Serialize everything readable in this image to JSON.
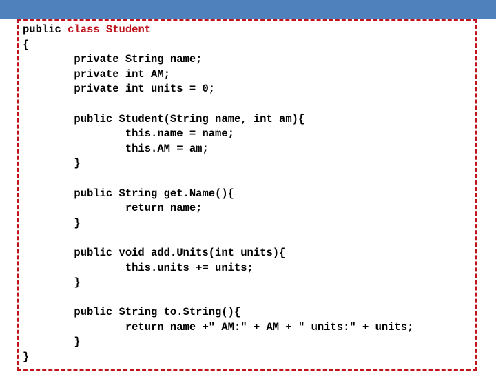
{
  "slide": {
    "header_bar_color": "#4f81bd",
    "border_color": "#c0141c"
  },
  "code": {
    "language": "java",
    "class_decl": {
      "public_kw": "public ",
      "highlight": "class Student"
    },
    "lines": [
      "{",
      "        private String name;",
      "        private int AM;",
      "        private int units = 0;",
      "",
      "        public Student(String name, int am){",
      "                this.name = name;",
      "                this.AM = am;",
      "        }",
      "",
      "        public String get.Name(){",
      "                return name;",
      "        }",
      "",
      "        public void add.Units(int units){",
      "                this.units += units;",
      "        }",
      "",
      "        public String to.String(){",
      "                return name +\" AM:\" + AM + \" units:\" + units;",
      "        }",
      "}"
    ]
  }
}
